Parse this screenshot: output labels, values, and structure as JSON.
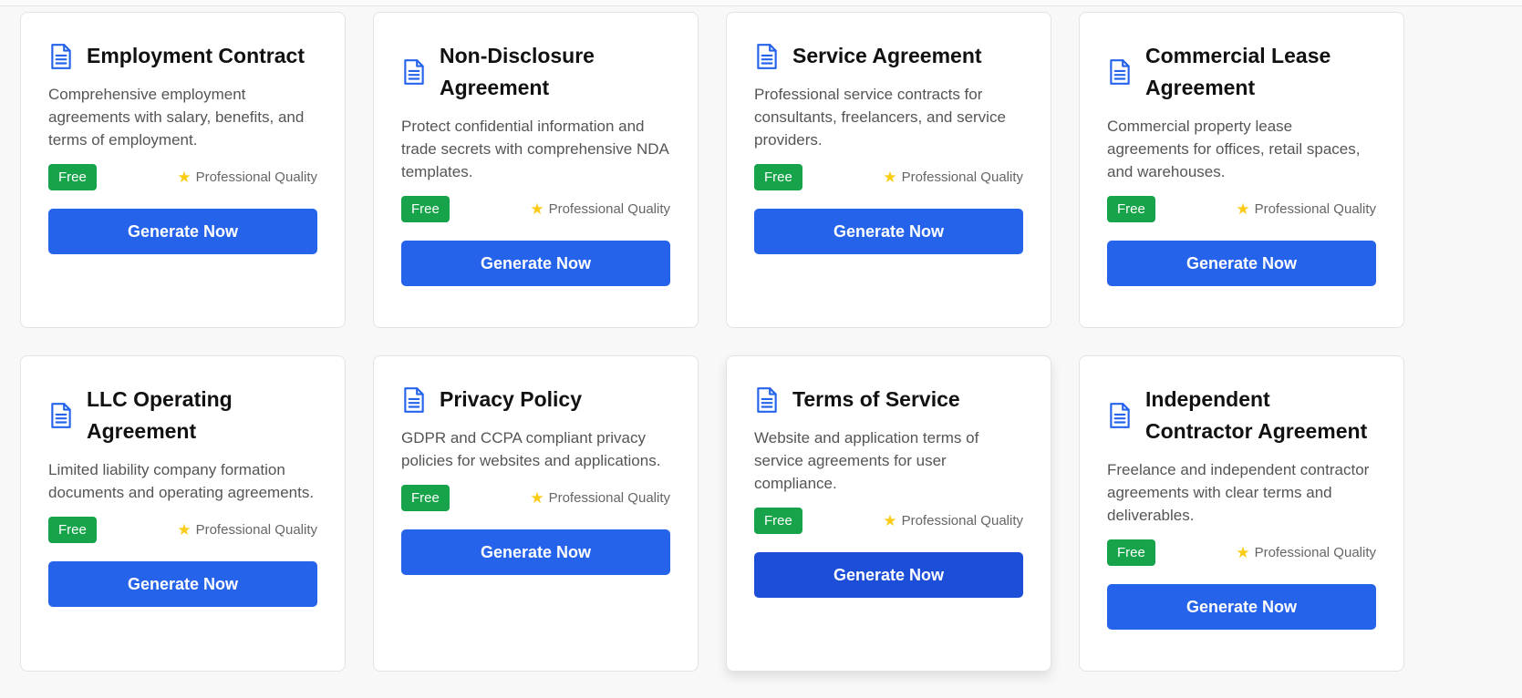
{
  "colors": {
    "accent": "#2563eb",
    "accent_hover": "#1d4ed8",
    "badge": "#16a34a",
    "star": "#facc15",
    "icon": "#2563eb"
  },
  "cards": [
    {
      "title": "Employment Contract",
      "description": "Comprehensive employment agreements with salary, benefits, and terms of employment.",
      "badge": "Free",
      "quality": "Professional Quality",
      "button": "Generate Now",
      "icon": "document-icon"
    },
    {
      "title": "Non-Disclosure Agreement",
      "description": "Protect confidential information and trade secrets with comprehensive NDA templates.",
      "badge": "Free",
      "quality": "Professional Quality",
      "button": "Generate Now",
      "icon": "document-icon"
    },
    {
      "title": "Service Agreement",
      "description": "Professional service contracts for consultants, freelancers, and service providers.",
      "badge": "Free",
      "quality": "Professional Quality",
      "button": "Generate Now",
      "icon": "document-icon"
    },
    {
      "title": "Commercial Lease Agreement",
      "description": "Commercial property lease agreements for offices, retail spaces, and warehouses.",
      "badge": "Free",
      "quality": "Professional Quality",
      "button": "Generate Now",
      "icon": "document-icon"
    },
    {
      "title": "LLC Operating Agreement",
      "description": "Limited liability company formation documents and operating agreements.",
      "badge": "Free",
      "quality": "Professional Quality",
      "button": "Generate Now",
      "icon": "document-icon"
    },
    {
      "title": "Privacy Policy",
      "description": "GDPR and CCPA compliant privacy policies for websites and applications.",
      "badge": "Free",
      "quality": "Professional Quality",
      "button": "Generate Now",
      "icon": "document-icon"
    },
    {
      "title": "Terms of Service",
      "description": "Website and application terms of service agreements for user compliance.",
      "badge": "Free",
      "quality": "Professional Quality",
      "button": "Generate Now",
      "icon": "document-icon"
    },
    {
      "title": "Independent Contractor Agreement",
      "description": "Freelance and independent contractor agreements with clear terms and deliverables.",
      "badge": "Free",
      "quality": "Professional Quality",
      "button": "Generate Now",
      "icon": "document-icon"
    }
  ]
}
